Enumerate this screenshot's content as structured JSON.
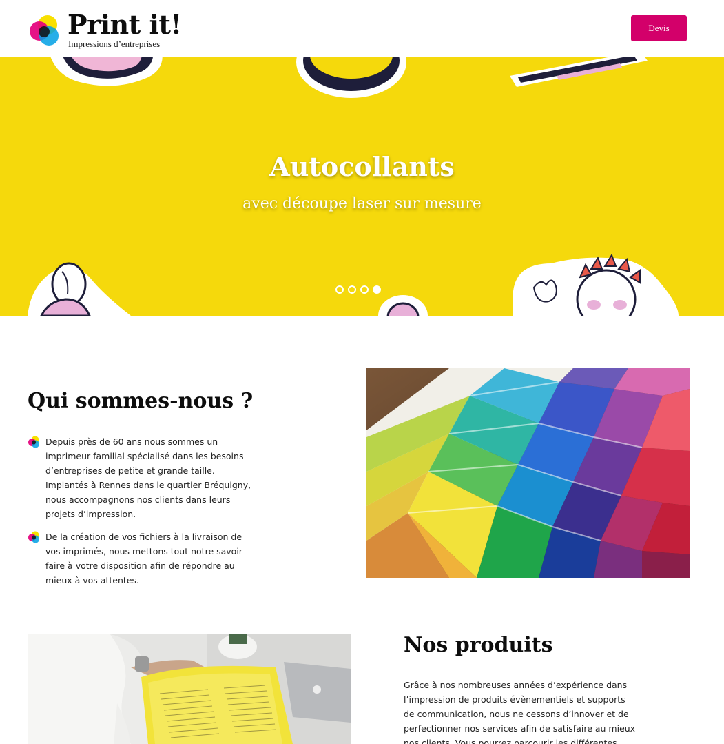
{
  "header": {
    "logo_title": "Print it!",
    "logo_subtitle": "Impressions d’entreprises",
    "devis_label": "Devis",
    "accent_color": "#d3006a"
  },
  "hero": {
    "title": "Autocollants",
    "subtitle": "avec découpe laser sur mesure",
    "background_color": "#f5d90c",
    "slides_count": 4,
    "active_slide": 4
  },
  "about": {
    "title": "Qui sommes-nous ?",
    "items": [
      "Depuis près de 60 ans nous sommes un imprimeur familial spécialisé dans les besoins d’entreprises de petite et grande taille. Implantés à Rennes dans le quartier Bréquigny, nous accompagnons nos clients dans leurs projets d’impression.",
      "De la création de vos fichiers à la livraison de vos imprimés, nous mettons tout notre savoir-faire à votre disposition afin de répondre au mieux à vos attentes."
    ],
    "bullet_icon": "cmy-circles-icon",
    "image": "pantone-color-swatches"
  },
  "products": {
    "title": "Nos produits",
    "text": "Grâce à nos nombreuses années d’expérience dans l’impression de produits évènementiels et supports de communication, nous ne cessons d’innover et de perfectionner nos services afin de satisfaire au mieux nos clients. Vous pourrez parcourir les différentes rubriques du",
    "image": "person-reading-yellow-printout"
  }
}
